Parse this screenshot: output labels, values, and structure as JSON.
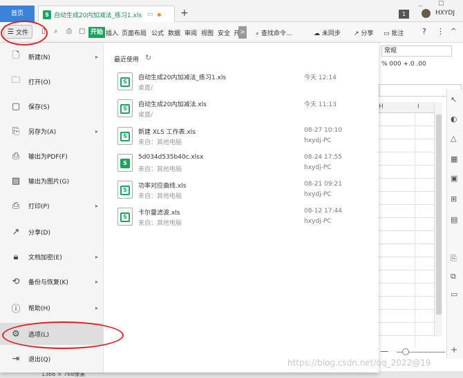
{
  "titlebar": {
    "home_tab": "首页",
    "doc_tab": "自动生成20内加减法_练习1.xls",
    "doc_tab_icon": "S",
    "new_tab": "+",
    "badge": "1",
    "username": "HXYDJ",
    "win_controls": [
      "_",
      "□"
    ]
  },
  "toolbar": {
    "file_label": "文件",
    "start_tab": "开始",
    "tabs": [
      "插入",
      "页面布局",
      "公式",
      "数据",
      "审阅",
      "视图",
      "安全",
      "开"
    ],
    "scroll_arrow": ">",
    "search_cmd": "查找命令...",
    "sync": "未同步",
    "share": "分享",
    "comment": "批注",
    "help": "?",
    "more": "⋮",
    "collapse": "^"
  },
  "sheet": {
    "number_format": "常规",
    "format_buttons": "%  000  +.0  .00",
    "col_h": "H",
    "col_i": "I",
    "zoom_minus": "—",
    "zoom_plus": "+"
  },
  "statusbar": {
    "text": "1366 × 768像素"
  },
  "file_menu": {
    "items": [
      {
        "label": "新建(N)",
        "icon": "new-icon",
        "has_arrow": true
      },
      {
        "label": "打开(O)",
        "icon": "open-folder-icon",
        "has_arrow": false
      },
      {
        "label": "保存(S)",
        "icon": "save-icon",
        "has_arrow": false
      },
      {
        "label": "另存为(A)",
        "icon": "save-as-icon",
        "has_arrow": true
      },
      {
        "label": "输出为PDF(F)",
        "icon": "pdf-icon",
        "has_arrow": false
      },
      {
        "label": "输出为图片(G)",
        "icon": "image-icon",
        "has_arrow": false
      },
      {
        "label": "打印(P)",
        "icon": "print-icon",
        "has_arrow": true
      },
      {
        "label": "分享(D)",
        "icon": "share-icon",
        "has_arrow": false
      },
      {
        "label": "文档加密(E)",
        "icon": "lock-icon",
        "has_arrow": true
      },
      {
        "label": "备份与恢复(K)",
        "icon": "backup-icon",
        "has_arrow": true
      },
      {
        "label": "帮助(H)",
        "icon": "help-icon",
        "has_arrow": true
      },
      {
        "label": "选项(L)",
        "icon": "gear-icon",
        "has_arrow": false
      },
      {
        "label": "退出(Q)",
        "icon": "exit-icon",
        "has_arrow": false
      }
    ],
    "recent_title": "最近使用",
    "recent_files": [
      {
        "name": "自动生成20内加减法_练习1.xls",
        "path": "桌面/",
        "date": "今天 12:14",
        "source": "",
        "solid": false
      },
      {
        "name": "自动生成20内加减法.xls",
        "path": "桌面/",
        "date": "今天 11:13",
        "source": "",
        "solid": false
      },
      {
        "name": "新建 XLS 工作表.xls",
        "path": "来自：其他电脑",
        "date": "08-27 10:10",
        "source": "hxydj-PC",
        "solid": false
      },
      {
        "name": "5d034d535b40c.xlsx",
        "path": "来自：其他电脑",
        "date": "08-24 17:55",
        "source": "hxydj-PC",
        "solid": true
      },
      {
        "name": "功率对应曲线.xls",
        "path": "来自：其他电脑",
        "date": "08-21 09:21",
        "source": "hxydj-PC",
        "solid": false
      },
      {
        "name": "卡尔曼滤波.xls",
        "path": "来自：其他电脑",
        "date": "08-12 17:44",
        "source": "hxydj-PC",
        "solid": false
      }
    ]
  },
  "watermark": "https://blog.csdn.net/qq_2022@19",
  "colors": {
    "accent_green": "#1aa35f",
    "home_tab_blue": "#3a83d8",
    "annotation_red": "#e01e1e"
  }
}
